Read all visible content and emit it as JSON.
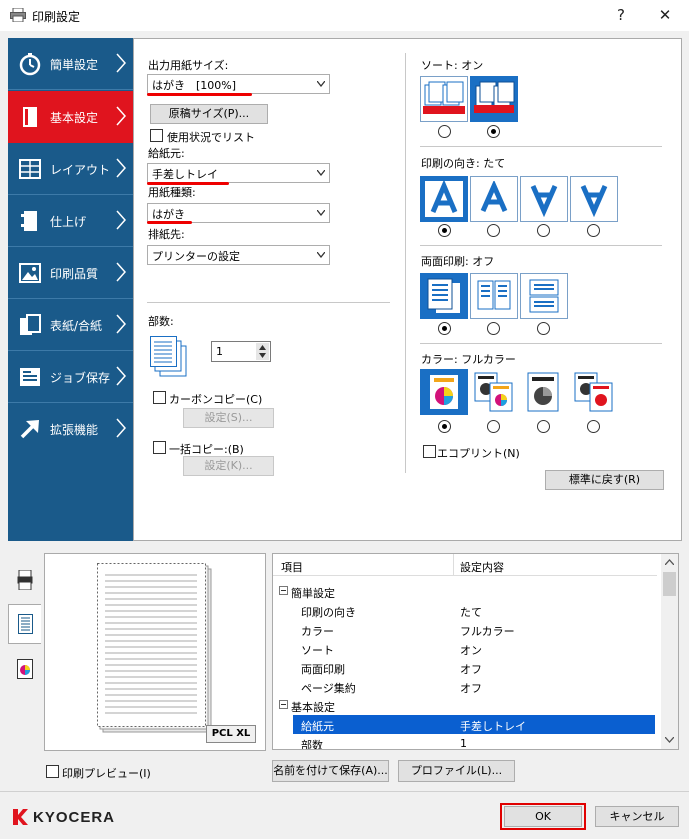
{
  "window": {
    "title": "印刷設定",
    "help": "?",
    "close": "✕"
  },
  "nav": {
    "items": [
      {
        "label": "簡単設定",
        "icon": "stopwatch-icon",
        "active": false
      },
      {
        "label": "基本設定",
        "icon": "page-icon",
        "active": true
      },
      {
        "label": "レイアウト",
        "icon": "layout-icon",
        "active": false
      },
      {
        "label": "仕上げ",
        "icon": "finishing-icon",
        "active": false
      },
      {
        "label": "印刷品質",
        "icon": "image-quality-icon",
        "active": false
      },
      {
        "label": "表紙/合紙",
        "icon": "cover-icon",
        "active": false
      },
      {
        "label": "ジョブ保存",
        "icon": "job-storage-icon",
        "active": false
      },
      {
        "label": "拡張機能",
        "icon": "arrow-up-right-icon",
        "active": false
      }
    ]
  },
  "paper": {
    "output_size_label": "出力用紙サイズ:",
    "output_size_value": "はがき　[100%]",
    "original_size_button": "原稿サイズ(P)...",
    "use_status_list": "使用状況でリスト",
    "source_label": "給紙元:",
    "source_value": "手差しトレイ",
    "type_label": "用紙種類:",
    "type_value": "はがき",
    "destination_label": "排紙先:",
    "destination_value": "プリンターの設定"
  },
  "copies": {
    "label": "部数:",
    "value": "1",
    "carbon_copy": "カーボンコピー(C)",
    "carbon_settings": "設定(S)...",
    "batch_copy": "一括コピー:(B)",
    "batch_settings": "設定(K)..."
  },
  "sort": {
    "label": "ソート:",
    "value": "オン",
    "selected": 1
  },
  "orientation": {
    "label": "印刷の向き:",
    "value": "たて",
    "selected": 0
  },
  "duplex": {
    "label": "両面印刷:",
    "value": "オフ",
    "selected": 0
  },
  "color": {
    "label": "カラー:",
    "value": "フルカラー",
    "selected": 0
  },
  "eco_print": "エコプリント(N)",
  "reset_button": "標準に戻す(R)",
  "preview": {
    "pdl": "PCL XL",
    "print_preview": "印刷プレビュー(I)"
  },
  "summary": {
    "col_item": "項目",
    "col_value": "設定内容",
    "rows": [
      {
        "key": "簡単設定",
        "value": "",
        "group": true
      },
      {
        "key": "印刷の向き",
        "value": "たて",
        "group": false
      },
      {
        "key": "カラー",
        "value": "フルカラー",
        "group": false
      },
      {
        "key": "ソート",
        "value": "オン",
        "group": false
      },
      {
        "key": "両面印刷",
        "value": "オフ",
        "group": false
      },
      {
        "key": "ページ集約",
        "value": "オフ",
        "group": false
      },
      {
        "key": "基本設定",
        "value": "",
        "group": true
      },
      {
        "key": "給紙元",
        "value": "手差しトレイ",
        "group": false,
        "highlight": true
      },
      {
        "key": "部数",
        "value": "1",
        "group": false
      }
    ]
  },
  "save_as_button": "名前を付けて保存(A)...",
  "profile_button": "プロファイル(L)...",
  "brand": "KYOCERA",
  "ok_button": "OK",
  "cancel_button": "キャンセル",
  "colors": {
    "nav_bg": "#1a5a8a",
    "nav_active": "#e0141e",
    "accent": "#1a6fc4",
    "highlight": "#0a5fd0",
    "ok_border": "#e00000"
  }
}
